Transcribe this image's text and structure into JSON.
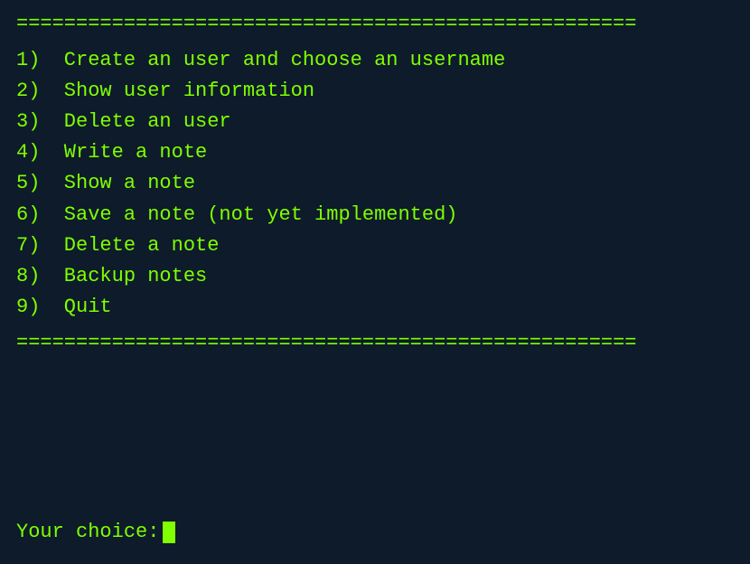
{
  "terminal": {
    "bg_color": "#0d1b2a",
    "text_color": "#7fff00",
    "divider": "====================================================",
    "menu": {
      "items": [
        {
          "number": "1",
          "label": "Create an user and choose an username"
        },
        {
          "number": "2",
          "label": "Show user information"
        },
        {
          "number": "3",
          "label": "Delete an user"
        },
        {
          "number": "4",
          "label": "Write a note"
        },
        {
          "number": "5",
          "label": "Show a note"
        },
        {
          "number": "6",
          "label": "Save a note (not yet implemented)"
        },
        {
          "number": "7",
          "label": "Delete a note"
        },
        {
          "number": "8",
          "label": "Backup notes"
        },
        {
          "number": "9",
          "label": "Quit"
        }
      ]
    },
    "prompt": {
      "label": "Your choice: "
    }
  }
}
